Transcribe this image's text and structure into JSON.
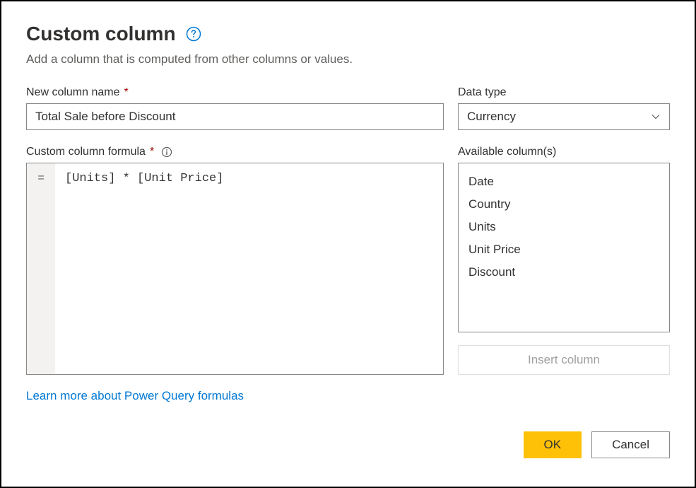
{
  "dialog": {
    "title": "Custom column",
    "subtitle": "Add a column that is computed from other columns or values."
  },
  "labels": {
    "new_column_name": "New column name",
    "data_type": "Data type",
    "custom_column_formula": "Custom column formula",
    "available_columns": "Available column(s)",
    "required_marker": "*"
  },
  "inputs": {
    "column_name_value": "Total Sale before Discount",
    "data_type_value": "Currency",
    "formula_equals": "=",
    "formula_value": "[Units] * [Unit Price]"
  },
  "available_columns": [
    "Date",
    "Country",
    "Units",
    "Unit Price",
    "Discount"
  ],
  "buttons": {
    "insert_column": "Insert column",
    "ok": "OK",
    "cancel": "Cancel"
  },
  "link": {
    "learn_more": "Learn more about Power Query formulas"
  }
}
